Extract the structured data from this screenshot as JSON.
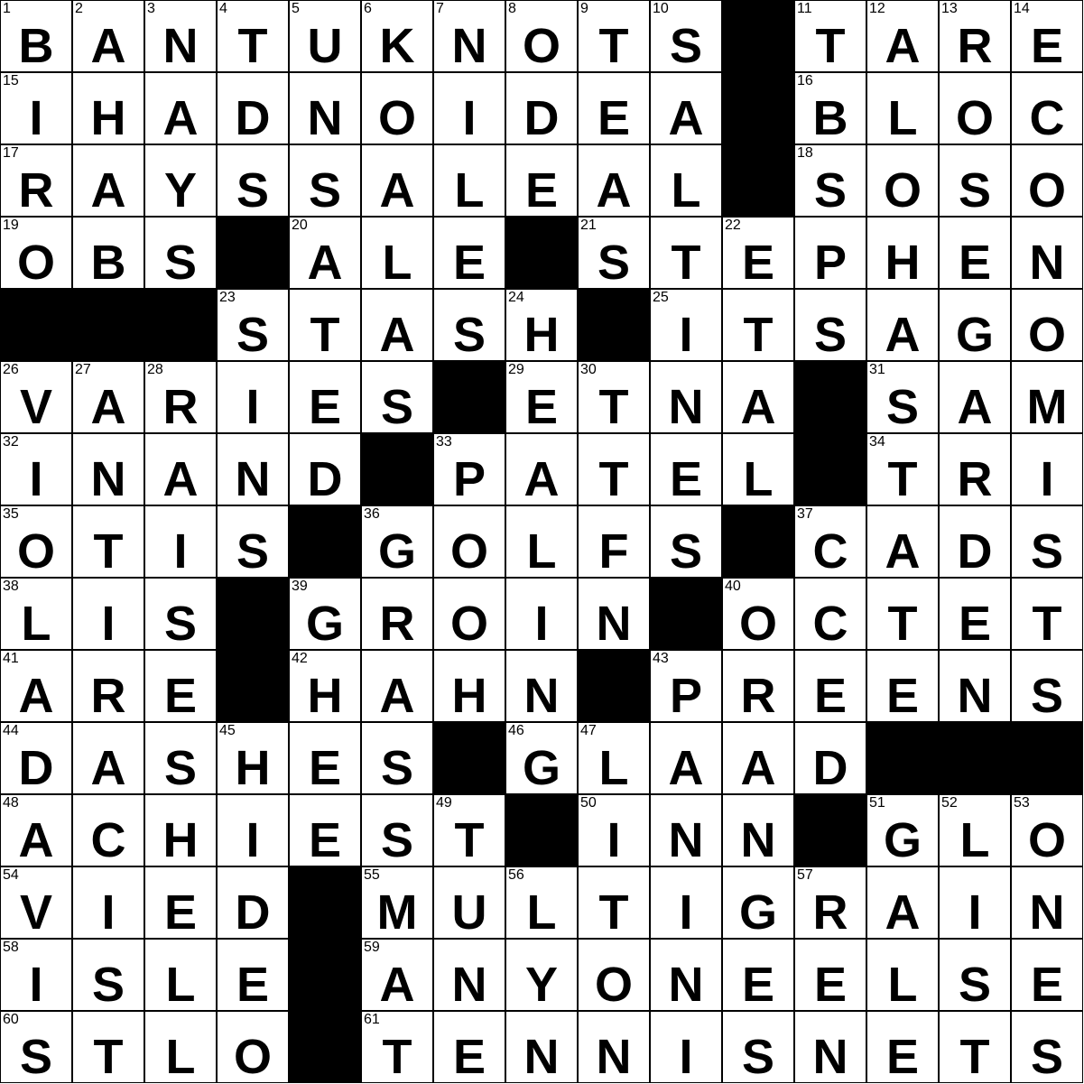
{
  "puzzle": {
    "size": 15,
    "colors": {
      "block": "#000000",
      "cell": "#ffffff",
      "text": "#000000"
    },
    "grid": [
      "BANTUKNOTS#TARE",
      "IHADNOIDEA#BLOC",
      "RAYSSALEAL#SOSO",
      "OBS#ALE#STEPHEN",
      "###STASH#ITSAGO",
      "VARIES#ETNA#SAM",
      "INAND#PATEL#TRI",
      "OTIS#GOLFS#CADS",
      "LIS#GROIN#OCTET",
      "ARE#HAHN#PREENS",
      "DASHES#GLAAD###",
      "ACHIEST#INN#GLO",
      "VIED#MULTIGRAIN",
      "ISLE#ANYONEELSE",
      "STLO#TENNISNETS"
    ],
    "numbers": [
      [
        1,
        2,
        3,
        4,
        5,
        6,
        7,
        8,
        9,
        10,
        null,
        11,
        12,
        13,
        14
      ],
      [
        15,
        null,
        null,
        null,
        null,
        null,
        null,
        null,
        null,
        null,
        null,
        16,
        null,
        null,
        null
      ],
      [
        17,
        null,
        null,
        null,
        null,
        null,
        null,
        null,
        null,
        null,
        null,
        18,
        null,
        null,
        null
      ],
      [
        19,
        null,
        null,
        null,
        20,
        null,
        null,
        null,
        21,
        null,
        22,
        null,
        null,
        null,
        null
      ],
      [
        null,
        null,
        null,
        23,
        null,
        null,
        null,
        24,
        null,
        25,
        null,
        null,
        null,
        null,
        null
      ],
      [
        26,
        27,
        28,
        null,
        null,
        null,
        null,
        29,
        30,
        null,
        null,
        null,
        31,
        null,
        null
      ],
      [
        32,
        null,
        null,
        null,
        null,
        null,
        33,
        null,
        null,
        null,
        null,
        null,
        34,
        null,
        null
      ],
      [
        35,
        null,
        null,
        null,
        null,
        36,
        null,
        null,
        null,
        null,
        null,
        37,
        null,
        null,
        null
      ],
      [
        38,
        null,
        null,
        null,
        39,
        null,
        null,
        null,
        null,
        null,
        40,
        null,
        null,
        null,
        null
      ],
      [
        41,
        null,
        null,
        null,
        42,
        null,
        null,
        null,
        null,
        43,
        null,
        null,
        null,
        null,
        null
      ],
      [
        44,
        null,
        null,
        45,
        null,
        null,
        null,
        46,
        47,
        null,
        null,
        null,
        null,
        null,
        null
      ],
      [
        48,
        null,
        null,
        null,
        null,
        null,
        49,
        null,
        50,
        null,
        null,
        null,
        51,
        52,
        53
      ],
      [
        54,
        null,
        null,
        null,
        null,
        55,
        null,
        56,
        null,
        null,
        null,
        57,
        null,
        null,
        null
      ],
      [
        58,
        null,
        null,
        null,
        null,
        59,
        null,
        null,
        null,
        null,
        null,
        null,
        null,
        null,
        null
      ],
      [
        60,
        null,
        null,
        null,
        null,
        61,
        null,
        null,
        null,
        null,
        null,
        null,
        null,
        null,
        null
      ]
    ]
  }
}
